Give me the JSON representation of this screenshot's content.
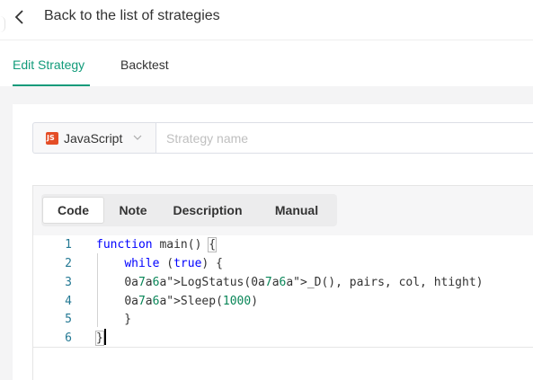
{
  "header": {
    "back_label": "Back to the list of strategies",
    "back_icon": "chevron-left-icon"
  },
  "tabs": [
    {
      "label": "Edit Strategy",
      "active": true
    },
    {
      "label": "Backtest",
      "active": false
    }
  ],
  "language_select": {
    "value": "JavaScript",
    "icon": "js-icon",
    "icon_text": "JS",
    "caret_icon": "chevron-down-icon"
  },
  "strategy_name": {
    "value": "",
    "placeholder": "Strategy name"
  },
  "editor_tabs": [
    {
      "label": "Code",
      "active": true
    },
    {
      "label": "Note",
      "active": false
    },
    {
      "label": "Description",
      "active": false
    },
    {
      "label": "Manual",
      "active": false
    }
  ],
  "code": {
    "line_numbers": [
      "1",
      "2",
      "3",
      "4",
      "5",
      "6"
    ],
    "lines": [
      "function main() {",
      "    while (true) {",
      "    LogStatus(_D(), pairs, col, htight)",
      "    Sleep(1000)",
      "    }",
      "}"
    ]
  },
  "colors": {
    "accent": "#129b7a",
    "keyword": "#0000ff",
    "line_number": "#237893",
    "js_badge": "#e44d26"
  }
}
